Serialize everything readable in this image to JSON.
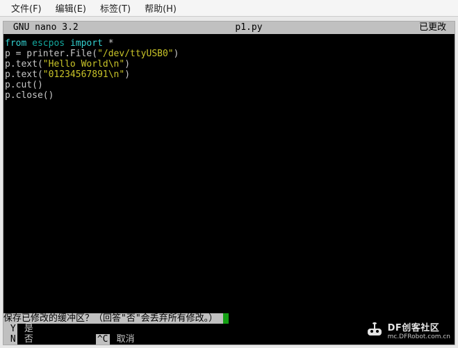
{
  "menu": {
    "file": "文件(F)",
    "edit": "编辑(E)",
    "tabs": "标签(T)",
    "help": "帮助(H)"
  },
  "status": {
    "left": " GNU nano 3.2",
    "center": "p1.py",
    "right": "已更改 "
  },
  "code": {
    "l1_kw1": "from",
    "l1_mod": " escpos ",
    "l1_kw2": "import",
    "l1_rest": " *",
    "l2_pre": "p = printer.File(",
    "l2_str": "\"/dev/ttyUSB0\"",
    "l2_post": ")",
    "l3_pre": "p.text(",
    "l3_str": "\"Hello World\\n\"",
    "l3_post": ")",
    "l4_pre": "p.text(",
    "l4_str": "\"01234567891\\n\"",
    "l4_post": ")",
    "l5": "p.cut()",
    "l6": "p.close()"
  },
  "prompt": {
    "question": "保存已修改的缓冲区？（回答\"否\"会丢弃所有修改。） ",
    "yes_key": " Y",
    "yes_label": " 是",
    "no_key": " N",
    "no_label": " 否",
    "cancel_key": "^C",
    "cancel_label": " 取消"
  },
  "watermark": {
    "line1": "DF创客社区",
    "line2": "mc.DFRobot.com.cn"
  }
}
